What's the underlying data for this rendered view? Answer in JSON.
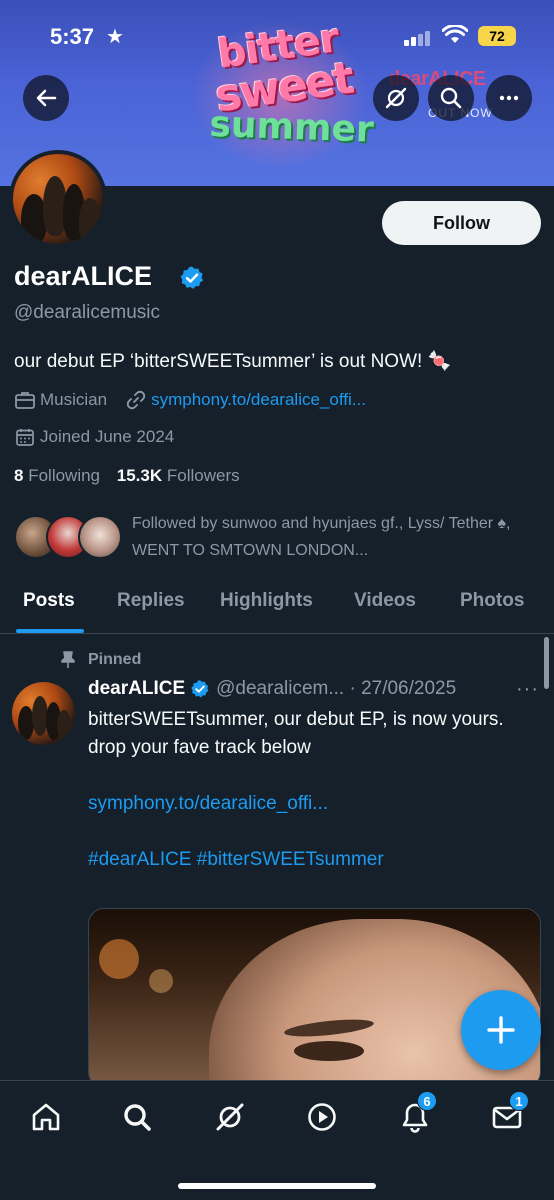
{
  "status_bar": {
    "time": "5:37",
    "battery": "72"
  },
  "banner": {
    "art_line1": "bitter",
    "art_line2": "sweet",
    "art_line3": "summer",
    "brand": "dearALICE",
    "subtitle": "OUT NOW"
  },
  "header": {
    "back_icon": "arrow-left-icon",
    "grok_icon": "grok-icon",
    "search_icon": "search-icon",
    "more_icon": "more-icon"
  },
  "profile": {
    "follow_label": "Follow",
    "display_name": "dearALICE",
    "handle": "@dearalicemusic",
    "bio": "our debut EP ‘bitterSWEETsummer’ is out NOW! 🍬",
    "category": "Musician",
    "website": "symphony.to/dearalice_offi...",
    "joined": "Joined June 2024",
    "following_count": "8",
    "following_label": "Following",
    "followers_count": "15.3K",
    "followers_label": "Followers",
    "followed_by": "Followed by sunwoo and hyunjaes gf., Lyss/ Tether ♠, WENT TO SMTOWN LONDON..."
  },
  "tabs": [
    "Posts",
    "Replies",
    "Highlights",
    "Videos",
    "Photos"
  ],
  "post": {
    "pinned_label": "Pinned",
    "author": "dearALICE",
    "handle_date": "@dearalicem... · 27/06/2025",
    "more": "···",
    "line1": "bitterSWEETsummer, our debut EP, is now yours.",
    "line2": "drop your fave track below",
    "link": "symphony.to/dearalice_offi...",
    "hashtags": "#dearALICE #bitterSWEETsummer"
  },
  "fab_label": "+",
  "bottom_nav": {
    "notifications_badge": "6",
    "messages_badge": "1"
  },
  "colors": {
    "background": "#15202b",
    "accent": "#1d9bf0",
    "secondary_text": "#8b98a5"
  }
}
